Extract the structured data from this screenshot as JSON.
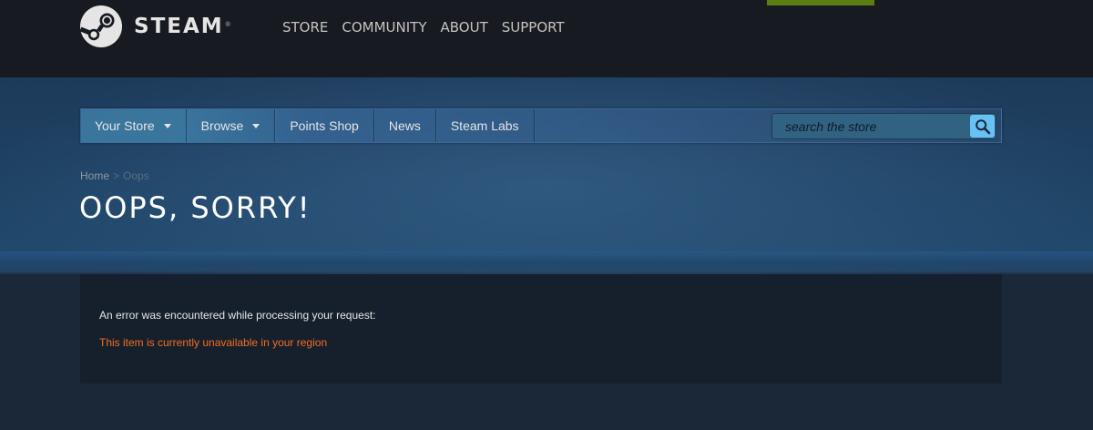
{
  "header": {
    "logo_text": "STEAM",
    "logo_reg": "®",
    "nav": [
      "STORE",
      "COMMUNITY",
      "ABOUT",
      "SUPPORT"
    ]
  },
  "store_nav": {
    "tabs": [
      {
        "label": "Your Store",
        "dropdown": true
      },
      {
        "label": "Browse",
        "dropdown": true
      },
      {
        "label": "Points Shop",
        "dropdown": false
      },
      {
        "label": "News",
        "dropdown": false
      },
      {
        "label": "Steam Labs",
        "dropdown": false
      }
    ],
    "search": {
      "placeholder": "search the store",
      "value": ""
    }
  },
  "breadcrumb": {
    "home": "Home",
    "separator": ">",
    "current": "Oops"
  },
  "page_title": "OOPS, SORRY!",
  "error": {
    "message": "An error was encountered while processing your request:",
    "detail": "This item is currently unavailable in your region"
  },
  "colors": {
    "header_bg": "#171a21",
    "page_bg": "#1b2838",
    "accent_green": "#5c7e10",
    "search_button": "#67c1f5",
    "error_text": "#f46d1b"
  }
}
